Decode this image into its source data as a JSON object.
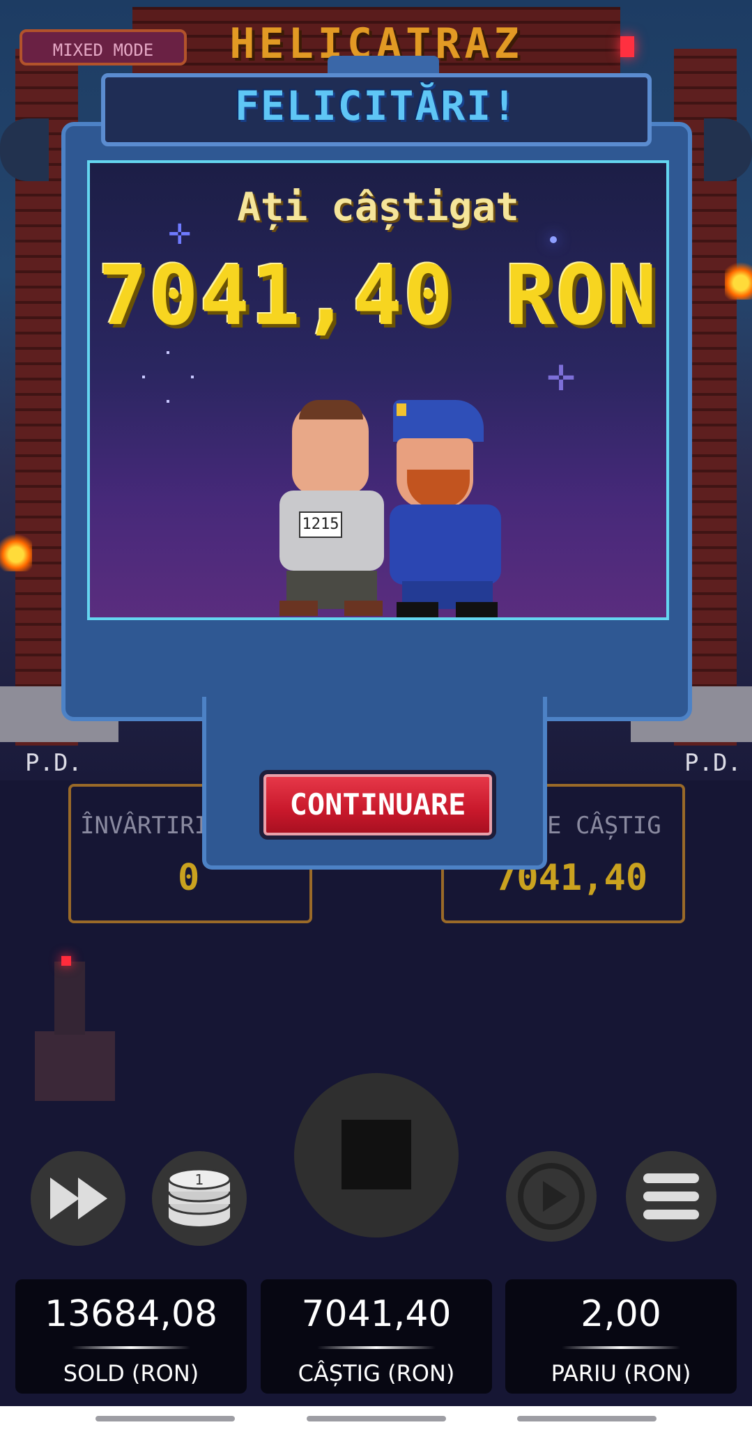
{
  "game": {
    "brand": "HELICATRAZ",
    "mode_badge": "MIXED MODE",
    "pd_left": "P.D.",
    "pd_right": "P.D."
  },
  "background_stats": {
    "free_spins_label": "ÎNVÂRTIRI G",
    "free_spins_value": "0",
    "total_win_label": "E CÂȘTIG",
    "total_win_value": "7041,40"
  },
  "popup": {
    "title": "FELICITĂRI!",
    "subtitle": "Ați câștigat",
    "amount": "7041,40 RON",
    "prisoner_number": "1215",
    "continue_label": "CONTINUARE"
  },
  "controls": {
    "turbo_icon": "fast-forward-icon",
    "bet_icon": "coin-stack-icon",
    "spin_icon": "stop-icon",
    "autoplay_icon": "autoplay-icon",
    "menu_icon": "hamburger-menu-icon"
  },
  "info_bar": [
    {
      "value": "13684,08",
      "label": "SOLD (RON)"
    },
    {
      "value": "7041,40",
      "label": "CÂȘTIG (RON)"
    },
    {
      "value": "2,00",
      "label": "PARIU (RON)"
    }
  ],
  "colors": {
    "win_amount": "#f7d520",
    "title": "#5fc6f5",
    "continue_button": "#c8182b",
    "popup_frame": "#2f5893"
  }
}
